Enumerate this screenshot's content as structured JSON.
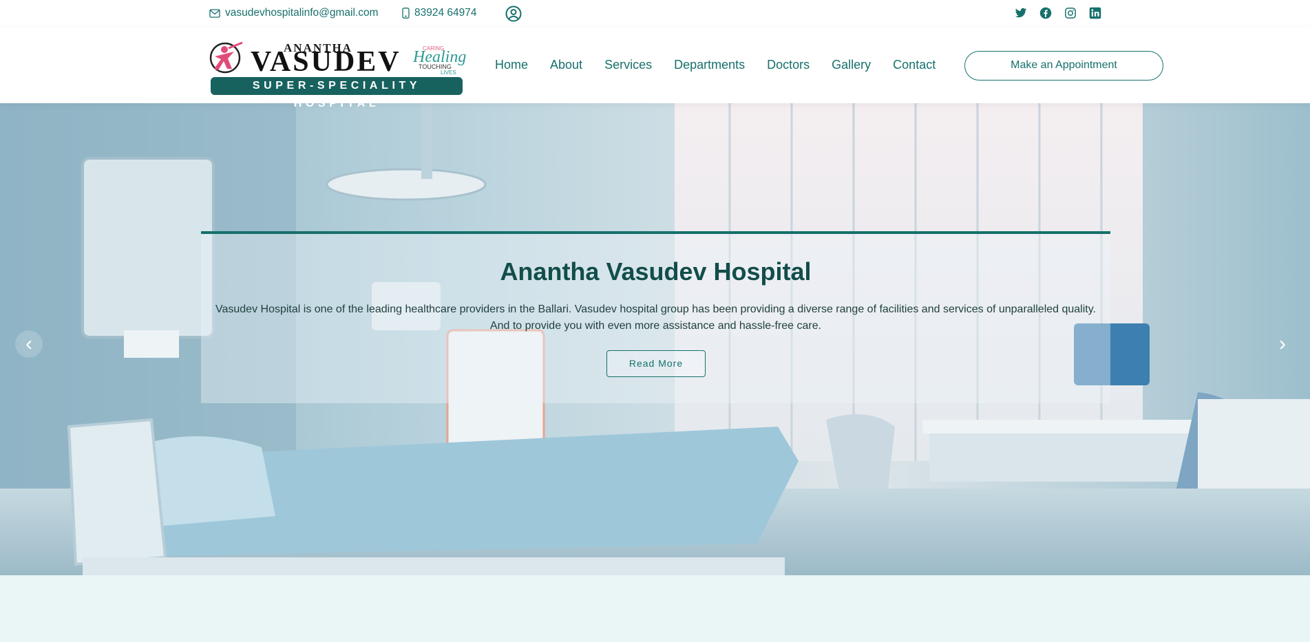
{
  "topbar": {
    "email": "vasudevhospitalinfo@gmail.com",
    "phone": "83924 64974",
    "socials": [
      "twitter-icon",
      "facebook-icon",
      "instagram-icon",
      "linkedin-icon"
    ]
  },
  "logo": {
    "top_word": "ANANTHA",
    "main_word": "VASUDEV",
    "tagline_1": "CARING",
    "tagline_2": "Healing",
    "tagline_3": "TOUCHING",
    "tagline_4": "LIVES",
    "bar_text": "SUPER-SPECIALITY HOSPITAL"
  },
  "nav": {
    "items": [
      "Home",
      "About",
      "Services",
      "Departments",
      "Doctors",
      "Gallery",
      "Contact"
    ],
    "appointment_label": "Make an Appointment"
  },
  "hero": {
    "title": "Anantha Vasudev Hospital",
    "description_line1": "Vasudev Hospital is one of the leading healthcare providers in the Ballari. Vasudev hospital group has been providing a diverse range of facilities and services of unparalleled quality.",
    "description_line2": "And to provide you with even more assistance and hassle-free care.",
    "read_more_label": "Read More",
    "prev_arrow": "‹",
    "next_arrow": "›"
  },
  "colors": {
    "brand": "#16706b",
    "brand_dark": "#124d4a",
    "section_bg": "#e9f6f5"
  }
}
